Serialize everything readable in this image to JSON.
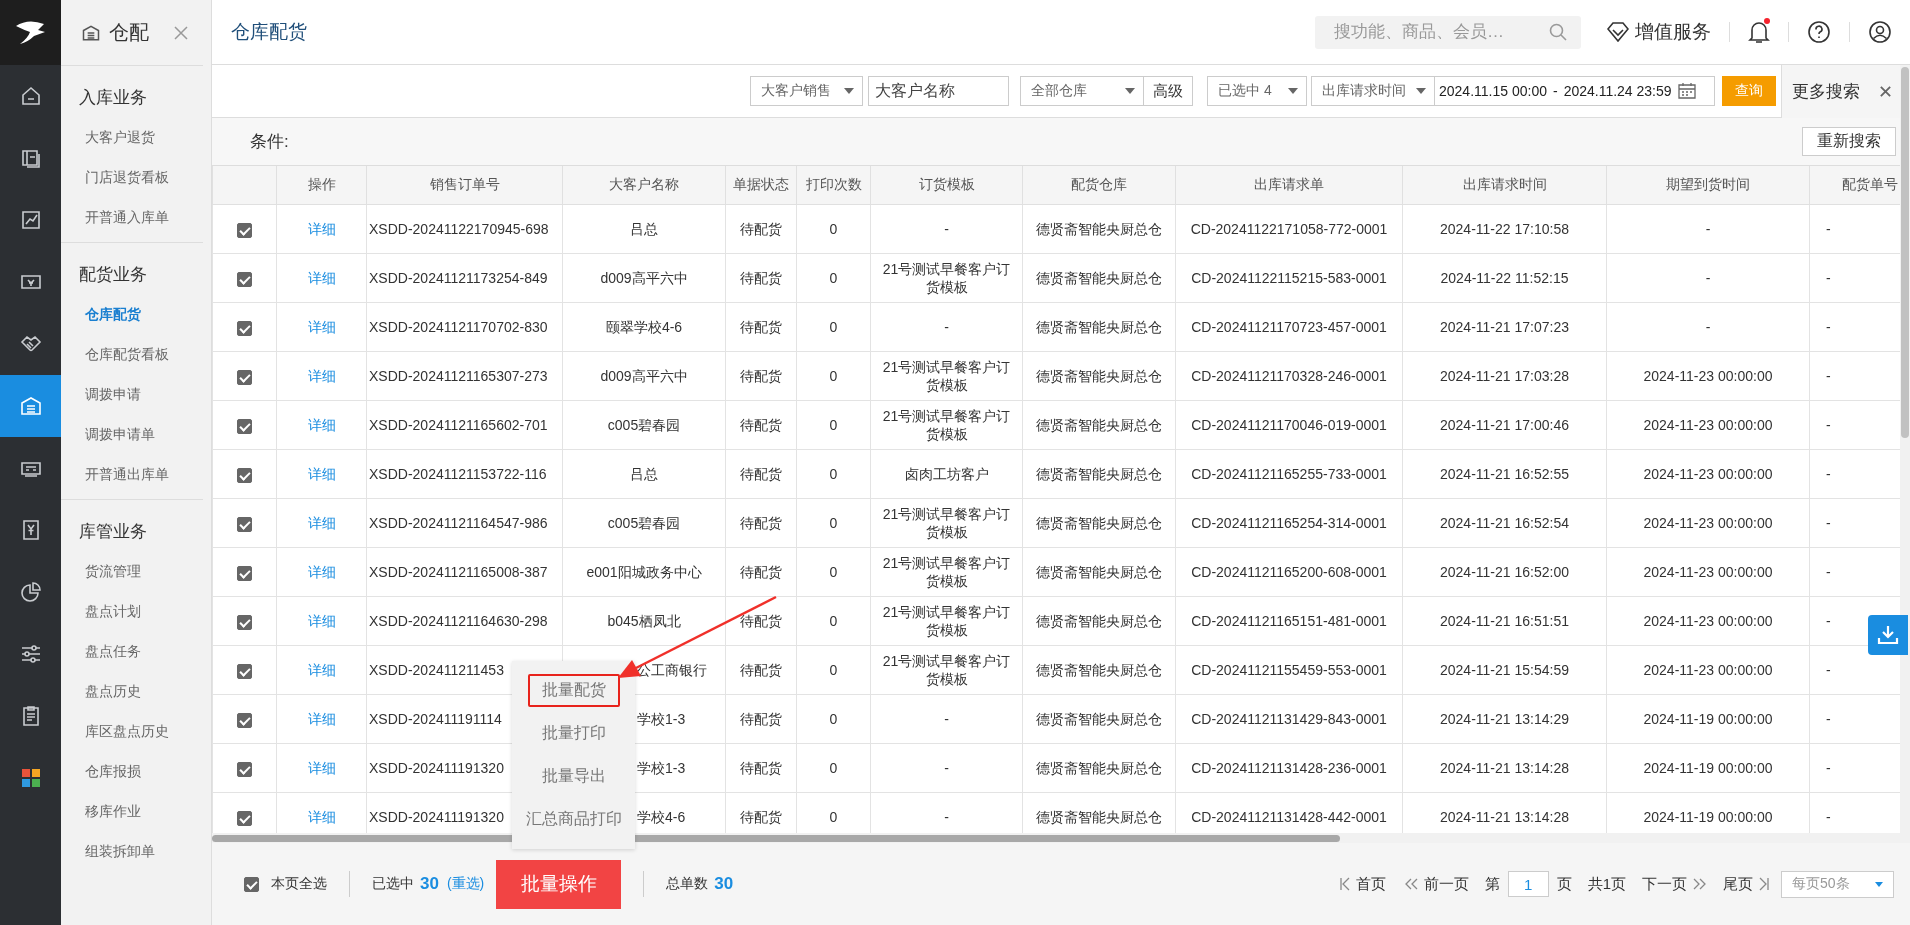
{
  "rail": {
    "items": [
      {
        "kind": "home",
        "selected": false
      },
      {
        "kind": "board",
        "selected": false
      },
      {
        "kind": "chart",
        "selected": false
      },
      {
        "kind": "money",
        "selected": false
      },
      {
        "kind": "handshake",
        "selected": false
      },
      {
        "kind": "warehouse",
        "selected": true
      },
      {
        "kind": "register",
        "selected": false
      },
      {
        "kind": "yen",
        "selected": false
      },
      {
        "kind": "pie",
        "selected": false
      },
      {
        "kind": "sliders",
        "selected": false
      },
      {
        "kind": "clipboard",
        "selected": false
      },
      {
        "kind": "apps",
        "selected": false
      }
    ]
  },
  "sidebar": {
    "title": "仓配",
    "groups": [
      {
        "title": "入库业务",
        "items": [
          {
            "label": "大客户退货",
            "selected": false
          },
          {
            "label": "门店退货看板",
            "selected": false
          },
          {
            "label": "开普通入库单",
            "selected": false
          }
        ]
      },
      {
        "title": "配货业务",
        "items": [
          {
            "label": "仓库配货",
            "selected": true
          },
          {
            "label": "仓库配货看板",
            "selected": false
          },
          {
            "label": "调拨申请",
            "selected": false
          },
          {
            "label": "调拨申请单",
            "selected": false
          },
          {
            "label": "开普通出库单",
            "selected": false
          }
        ]
      },
      {
        "title": "库管业务",
        "items": [
          {
            "label": "货流管理",
            "selected": false
          },
          {
            "label": "盘点计划",
            "selected": false
          },
          {
            "label": "盘点任务",
            "selected": false
          },
          {
            "label": "盘点历史",
            "selected": false
          },
          {
            "label": "库区盘点历史",
            "selected": false
          },
          {
            "label": "仓库报损",
            "selected": false
          },
          {
            "label": "移库作业",
            "selected": false
          },
          {
            "label": "组装拆卸单",
            "selected": false
          }
        ]
      }
    ]
  },
  "header": {
    "title": "仓库配货",
    "search": {
      "placeholder": "搜功能、商品、会员…"
    },
    "value_service": "增值服务",
    "notifications": {
      "unread": true
    }
  },
  "filters": {
    "sales_type": "大客户销售",
    "customer_name": {
      "placeholder": "大客户名称"
    },
    "warehouse": "全部仓库",
    "advanced": "高级",
    "status": "已选中 4",
    "time_field": "出库请求时间",
    "date_from": "2024.11.15 00:00",
    "date_separator": "-",
    "date_to": "2024.11.24 23:59",
    "query": "查询",
    "more_search": "更多搜索"
  },
  "conditions": {
    "label": "条件:",
    "research": "重新搜索"
  },
  "table": {
    "columns": [
      "操作",
      "销售订单号",
      "大客户名称",
      "单据状态",
      "打印次数",
      "订货模板",
      "配货仓库",
      "出库请求单",
      "出库请求时间",
      "期望到货时间",
      "配货单号"
    ],
    "rows": [
      {
        "checked": true,
        "covered": false,
        "cells": [
          "详细",
          "XSDD-20241122170945-698",
          "吕总",
          "待配货",
          "0",
          "-",
          "德贤斋智能央厨总仓",
          "CD-20241122171058-772-0001",
          "2024-11-22 17:10:58",
          "-",
          "-"
        ]
      },
      {
        "checked": true,
        "covered": false,
        "cells": [
          "详细",
          "XSDD-20241121173254-849",
          "d009高平六中",
          "待配货",
          "0",
          "21号测试早餐客户订货模板",
          "德贤斋智能央厨总仓",
          "CD-20241122115215-583-0001",
          "2024-11-22 11:52:15",
          "-",
          "-"
        ]
      },
      {
        "checked": true,
        "covered": false,
        "cells": [
          "详细",
          "XSDD-20241121170702-830",
          "颐翠学校4-6",
          "待配货",
          "0",
          "-",
          "德贤斋智能央厨总仓",
          "CD-20241121170723-457-0001",
          "2024-11-21 17:07:23",
          "-",
          "-"
        ]
      },
      {
        "checked": true,
        "covered": false,
        "cells": [
          "详细",
          "XSDD-20241121165307-273",
          "d009高平六中",
          "待配货",
          "0",
          "21号测试早餐客户订货模板",
          "德贤斋智能央厨总仓",
          "CD-20241121170328-246-0001",
          "2024-11-21 17:03:28",
          "2024-11-23 00:00:00",
          "-"
        ]
      },
      {
        "checked": true,
        "covered": false,
        "cells": [
          "详细",
          "XSDD-20241121165602-701",
          "c005碧春园",
          "待配货",
          "0",
          "21号测试早餐客户订货模板",
          "德贤斋智能央厨总仓",
          "CD-20241121170046-019-0001",
          "2024-11-21 17:00:46",
          "2024-11-23 00:00:00",
          "-"
        ]
      },
      {
        "checked": true,
        "covered": false,
        "cells": [
          "详细",
          "XSDD-20241121153722-116",
          "吕总",
          "待配货",
          "0",
          "卤肉工坊客户",
          "德贤斋智能央厨总仓",
          "CD-20241121165255-733-0001",
          "2024-11-21 16:52:55",
          "2024-11-23 00:00:00",
          "-"
        ]
      },
      {
        "checked": true,
        "covered": false,
        "cells": [
          "详细",
          "XSDD-20241121164547-986",
          "c005碧春园",
          "待配货",
          "0",
          "21号测试早餐客户订货模板",
          "德贤斋智能央厨总仓",
          "CD-20241121165254-314-0001",
          "2024-11-21 16:52:54",
          "2024-11-23 00:00:00",
          "-"
        ]
      },
      {
        "checked": true,
        "covered": false,
        "cells": [
          "详细",
          "XSDD-20241121165008-387",
          "e001阳城政务中心",
          "待配货",
          "0",
          "21号测试早餐客户订货模板",
          "德贤斋智能央厨总仓",
          "CD-20241121165200-608-0001",
          "2024-11-21 16:52:00",
          "2024-11-23 00:00:00",
          "-"
        ]
      },
      {
        "checked": true,
        "covered": false,
        "cells": [
          "详细",
          "XSDD-20241121164630-298",
          "b045栖凤北",
          "待配货",
          "0",
          "21号测试早餐客户订货模板",
          "德贤斋智能央厨总仓",
          "CD-20241121165151-481-0001",
          "2024-11-21 16:51:51",
          "2024-11-23 00:00:00",
          "-"
        ]
      },
      {
        "checked": true,
        "covered": true,
        "cells": [
          "详细",
          "XSDD-202411211453",
          "公工商银行",
          "待配货",
          "0",
          "21号测试早餐客户订货模板",
          "德贤斋智能央厨总仓",
          "CD-20241121155459-553-0001",
          "2024-11-21 15:54:59",
          "2024-11-23 00:00:00",
          "-"
        ]
      },
      {
        "checked": true,
        "covered": true,
        "cells": [
          "详细",
          "XSDD-202411191114",
          "学校1-3",
          "待配货",
          "0",
          "-",
          "德贤斋智能央厨总仓",
          "CD-20241121131429-843-0001",
          "2024-11-21 13:14:29",
          "2024-11-19 00:00:00",
          "-"
        ]
      },
      {
        "checked": true,
        "covered": true,
        "cells": [
          "详细",
          "XSDD-202411191320",
          "学校1-3",
          "待配货",
          "0",
          "-",
          "德贤斋智能央厨总仓",
          "CD-20241121131428-236-0001",
          "2024-11-21 13:14:28",
          "2024-11-19 00:00:00",
          "-"
        ]
      },
      {
        "checked": true,
        "covered": true,
        "cells": [
          "详细",
          "XSDD-202411191320",
          "学校4-6",
          "待配货",
          "0",
          "-",
          "德贤斋智能央厨总仓",
          "CD-20241121131428-442-0001",
          "2024-11-21 13:14:28",
          "2024-11-19 00:00:00",
          "-"
        ]
      }
    ]
  },
  "batch_menu": {
    "items": [
      {
        "label": "批量配货",
        "highlighted": true
      },
      {
        "label": "批量打印",
        "highlighted": false
      },
      {
        "label": "批量导出",
        "highlighted": false
      },
      {
        "label": "汇总商品打印",
        "highlighted": false
      }
    ]
  },
  "footer": {
    "select_all": {
      "label": "本页全选",
      "checked": true
    },
    "selected_label": "已选中",
    "selected_count": "30",
    "reselect": "(重选)",
    "batch_button": "批量操作",
    "total_label": "总单数",
    "total_count": "30",
    "pagination": {
      "first": "首页",
      "prev": "前一页",
      "page_prefix": "第",
      "page": "1",
      "page_suffix": "页",
      "total_pages": "共1页",
      "next": "下一页",
      "last": "尾页",
      "page_size": "每页50条"
    }
  }
}
